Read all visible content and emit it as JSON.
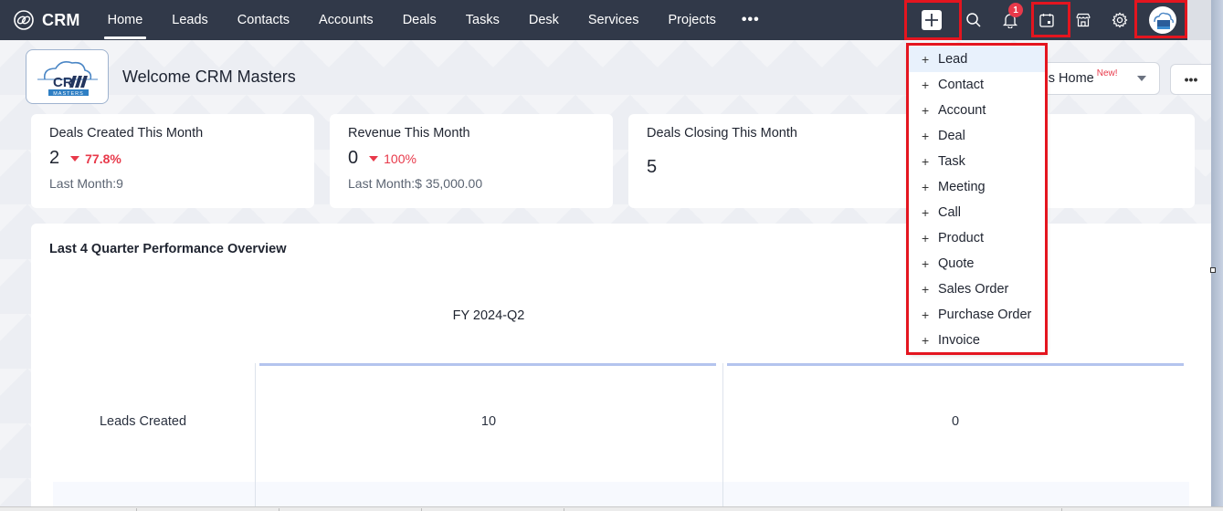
{
  "app": {
    "name": "CRM"
  },
  "nav": {
    "tabs": [
      {
        "label": "Home",
        "active": true
      },
      {
        "label": "Leads"
      },
      {
        "label": "Contacts"
      },
      {
        "label": "Accounts"
      },
      {
        "label": "Deals"
      },
      {
        "label": "Tasks"
      },
      {
        "label": "Desk"
      },
      {
        "label": "Services"
      },
      {
        "label": "Projects"
      }
    ],
    "more_label": "•••",
    "icons": [
      "plus-icon",
      "search-icon",
      "bell-icon",
      "calendar-icon",
      "marketplace-icon",
      "gear-icon",
      "avatar"
    ],
    "notification_count": "1"
  },
  "header": {
    "welcome": "Welcome CRM Masters",
    "logo_text": "CRM",
    "logo_subtext": "MASTERS",
    "home_select": {
      "value": "'s Home",
      "badge": "New!"
    },
    "more_label": "•••"
  },
  "create_menu": {
    "items": [
      {
        "label": "Lead",
        "hover": true
      },
      {
        "label": "Contact"
      },
      {
        "label": "Account"
      },
      {
        "label": "Deal"
      },
      {
        "label": "Task"
      },
      {
        "label": "Meeting"
      },
      {
        "label": "Call"
      },
      {
        "label": "Product"
      },
      {
        "label": "Quote"
      },
      {
        "label": "Sales Order"
      },
      {
        "label": "Purchase Order"
      },
      {
        "label": "Invoice"
      }
    ],
    "plus": "+"
  },
  "stats": [
    {
      "title": "Deals Created This Month",
      "value": "2",
      "delta": "77.8%",
      "sub": "Last Month:9"
    },
    {
      "title": "Revenue This Month",
      "value": "0",
      "delta": "100%",
      "sub": "Last Month:$ 35,000.00"
    },
    {
      "title": "Deals Closing This Month",
      "value": "5"
    }
  ],
  "performance": {
    "title": "Last 4 Quarter Performance Overview",
    "quarters": [
      "FY 2024-Q2",
      ""
    ],
    "rows": [
      {
        "label": "Leads Created",
        "values": [
          "10",
          "0"
        ]
      }
    ]
  },
  "colors": {
    "nav_bg": "#313949",
    "negative": "#e8394a",
    "highlight": "#e4151f",
    "accent_bar": "#b4c4ee"
  }
}
